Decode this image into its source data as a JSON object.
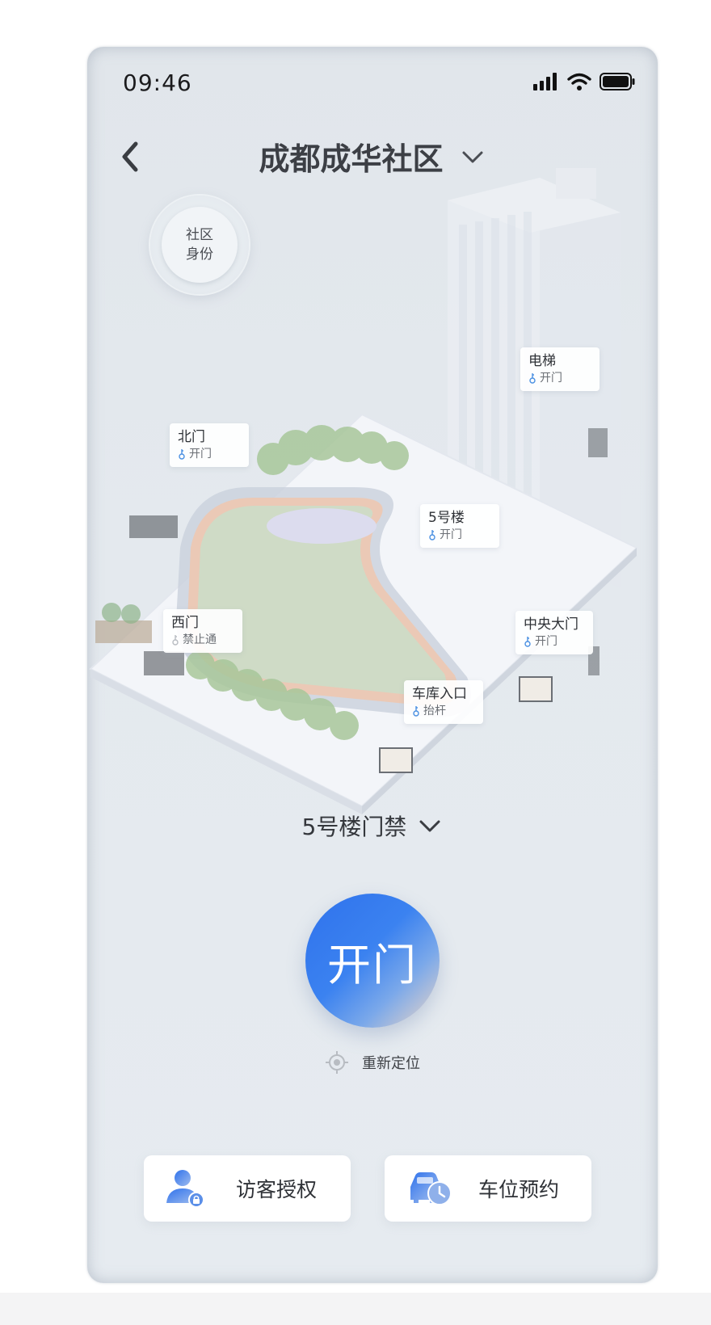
{
  "status_bar": {
    "time": "09:46"
  },
  "header": {
    "title": "成都成华社区"
  },
  "identity": {
    "line1": "社区",
    "line2": "身份"
  },
  "map_labels": [
    {
      "name": "电梯",
      "status": "开门",
      "enabled": true
    },
    {
      "name": "北门",
      "status": "开门",
      "enabled": true
    },
    {
      "name": "5号楼",
      "status": "开门",
      "enabled": true
    },
    {
      "name": "西门",
      "status": "禁止通",
      "enabled": false
    },
    {
      "name": "中央大门",
      "status": "开门",
      "enabled": true
    },
    {
      "name": "车库入口",
      "status": "抬杆",
      "enabled": true
    }
  ],
  "door_selector": {
    "value": "5号楼门禁"
  },
  "open_button": {
    "label": "开门"
  },
  "relocate": {
    "label": "重新定位"
  },
  "actions": [
    {
      "label": "访客授权",
      "icon": "visitor-icon"
    },
    {
      "label": "车位预约",
      "icon": "parking-reservation-icon"
    }
  ],
  "colors": {
    "accent": "#2f72ec",
    "enabled_key": "#4a90e2",
    "disabled_key": "#b8bcc2"
  }
}
